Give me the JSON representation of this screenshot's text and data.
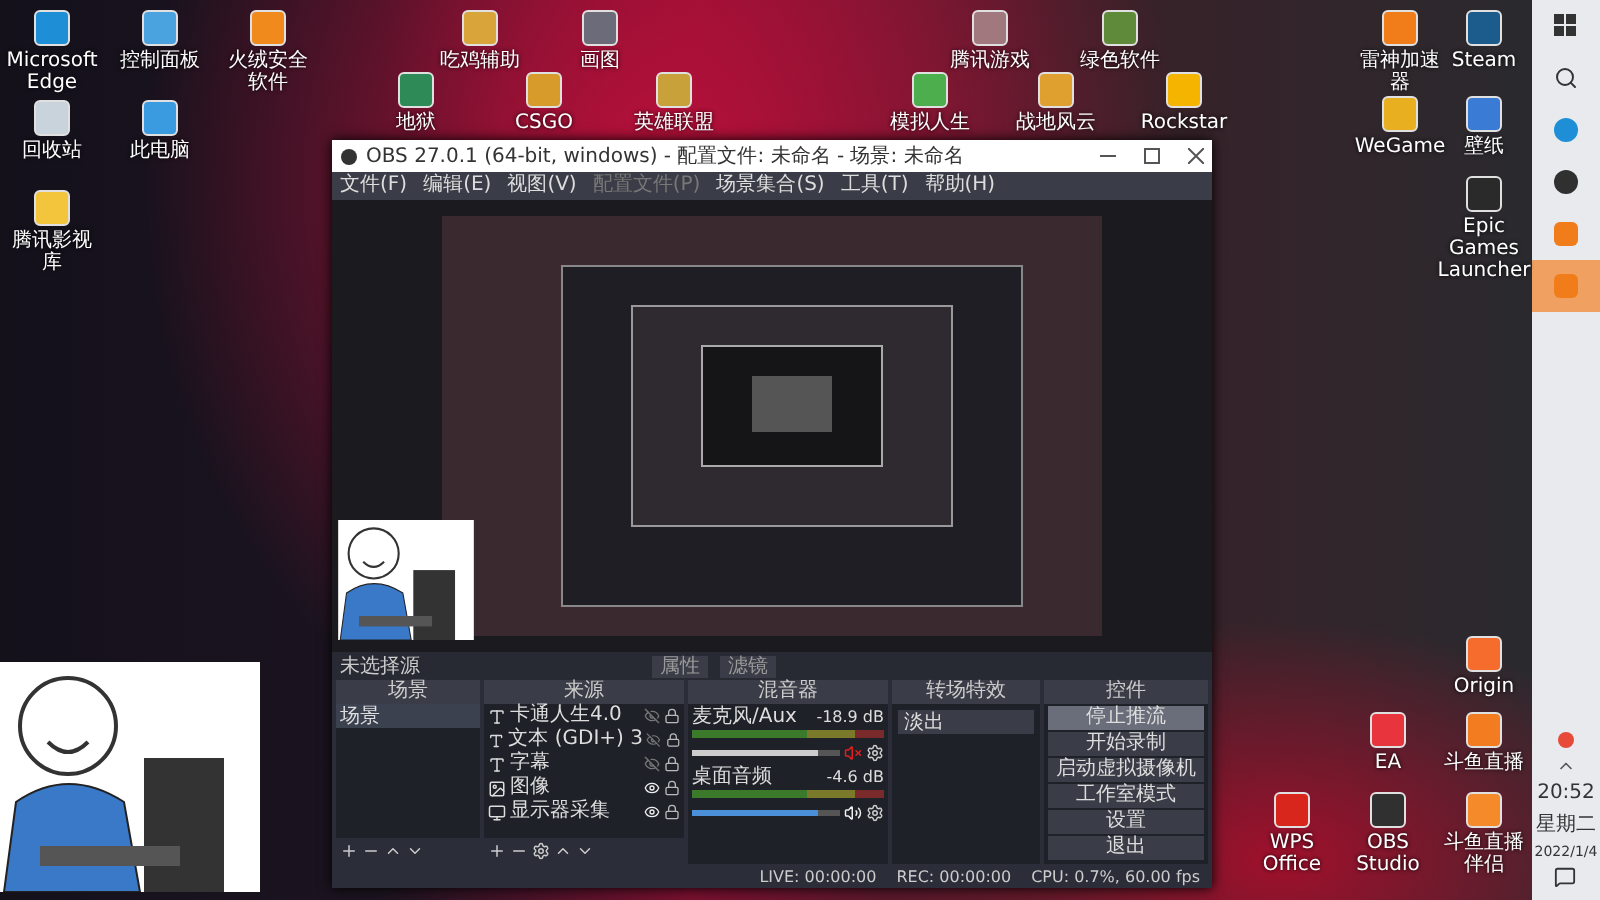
{
  "desktop_icons": [
    {
      "label": "Microsoft Edge",
      "color": "#1e8fd6"
    },
    {
      "label": "控制面板",
      "color": "#4aa3df"
    },
    {
      "label": "火绒安全软件",
      "color": "#f08a1c"
    },
    {
      "label": "回收站",
      "color": "#c9d3dc"
    },
    {
      "label": "此电脑",
      "color": "#3b9be0"
    },
    {
      "label": "腾讯影视库",
      "color": "#f2c53d"
    },
    {
      "label": "吃鸡辅助",
      "color": "#d9a43a"
    },
    {
      "label": "画图",
      "color": "#6b6b7a"
    },
    {
      "label": "腾讯游戏",
      "color": "#a0787e"
    },
    {
      "label": "绿色软件",
      "color": "#5f8a3a"
    },
    {
      "label": "雷神加速器",
      "color": "#f07c1a"
    },
    {
      "label": "Steam",
      "color": "#1b5c8c"
    },
    {
      "label": "地狱",
      "color": "#2e8b57"
    },
    {
      "label": "CSGO",
      "color": "#d69b2b"
    },
    {
      "label": "英雄联盟",
      "color": "#c9a13b"
    },
    {
      "label": "模拟人生",
      "color": "#4cae4c"
    },
    {
      "label": "战地风云",
      "color": "#e0a030"
    },
    {
      "label": "Rockstar",
      "color": "#f4b400"
    },
    {
      "label": "WeGame",
      "color": "#e8b020"
    },
    {
      "label": "壁纸",
      "color": "#3a7bd5"
    },
    {
      "label": "Epic Games Launcher",
      "color": "#2a2a2a"
    },
    {
      "label": "Origin",
      "color": "#f56c2d"
    },
    {
      "label": "EA",
      "color": "#e8343c"
    },
    {
      "label": "斗鱼直播",
      "color": "#f47c20"
    },
    {
      "label": "WPS Office",
      "color": "#d9261c"
    },
    {
      "label": "OBS Studio",
      "color": "#303030"
    },
    {
      "label": "斗鱼直播伴侣",
      "color": "#f58a2a"
    }
  ],
  "obs_window": {
    "title": "OBS 27.0.1 (64-bit, windows) - 配置文件: 未命名 - 场景: 未命名",
    "menu": [
      {
        "label": "文件(F)",
        "disabled": false
      },
      {
        "label": "编辑(E)",
        "disabled": false
      },
      {
        "label": "视图(V)",
        "disabled": false
      },
      {
        "label": "配置文件(P)",
        "disabled": true
      },
      {
        "label": "场景集合(S)",
        "disabled": false
      },
      {
        "label": "工具(T)",
        "disabled": false
      },
      {
        "label": "帮助(H)",
        "disabled": false
      }
    ],
    "source_bar": {
      "label": "未选择源",
      "buttons": [
        "属性",
        "滤镜"
      ]
    },
    "scenes": {
      "title": "场景",
      "items": [
        {
          "label": "场景",
          "selected": true
        }
      ]
    },
    "sources": {
      "title": "来源",
      "items": [
        {
          "label": "卡通人生4.0",
          "kind": "text",
          "visible": false
        },
        {
          "label": "文本 (GDI+) 3",
          "kind": "text",
          "visible": false
        },
        {
          "label": "字幕",
          "kind": "text",
          "visible": false
        },
        {
          "label": "图像",
          "kind": "image",
          "visible": true
        },
        {
          "label": "显示器采集",
          "kind": "display",
          "visible": true
        }
      ]
    },
    "mixer": {
      "title": "混音器",
      "channels": [
        {
          "name": "麦克风/Aux",
          "reading": "-18.9 dB",
          "muted": true,
          "level": 0.85
        },
        {
          "name": "桌面音频",
          "reading": "-4.6 dB",
          "muted": false,
          "level": 0.85
        }
      ]
    },
    "transitions": {
      "title": "转场特效",
      "value": "淡出"
    },
    "controls": {
      "title": "控件",
      "buttons": [
        {
          "label": "停止推流",
          "active": true
        },
        {
          "label": "开始录制",
          "active": false
        },
        {
          "label": "启动虚拟摄像机",
          "active": false
        },
        {
          "label": "工作室模式",
          "active": false
        },
        {
          "label": "设置",
          "active": false
        },
        {
          "label": "退出",
          "active": false
        }
      ]
    },
    "status_bar": {
      "live": "LIVE: 00:00:00",
      "rec": "REC: 00:00:00",
      "cpu": "CPU: 0.7%, 60.00 fps"
    }
  },
  "taskbar": {
    "apps": [
      {
        "kind": "edge",
        "selected": false
      },
      {
        "kind": "obs",
        "selected": false
      },
      {
        "kind": "app",
        "selected": false
      },
      {
        "kind": "app",
        "selected": true
      }
    ],
    "time": "20:52",
    "weekday": "星期二",
    "date": "2022/1/4"
  }
}
